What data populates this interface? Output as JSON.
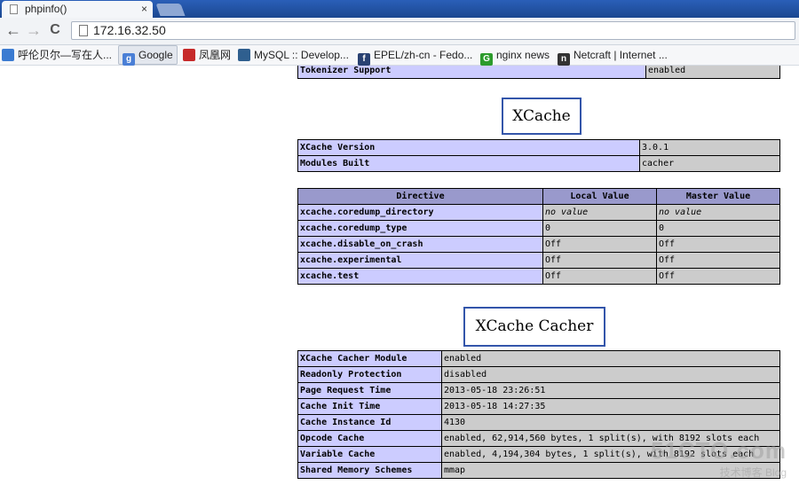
{
  "browser": {
    "tab_title": "phpinfo()",
    "tab_close": "×",
    "back": "←",
    "forward": "→",
    "reload": "C",
    "url": "172.16.32.50"
  },
  "bookmarks": [
    {
      "label": "呼伦贝尔—写在人...",
      "icon": "bookmark-icon",
      "color": "#3b7bd1"
    },
    {
      "label": "Google",
      "icon": "google-icon",
      "color": "#4a7fd6"
    },
    {
      "label": "凤凰网",
      "icon": "ifeng-icon",
      "color": "#c62a2a"
    },
    {
      "label": "MySQL :: Develop...",
      "icon": "mysql-icon",
      "color": "#2f5f8f"
    },
    {
      "label": "EPEL/zh-cn - Fedo...",
      "icon": "fedora-icon",
      "color": "#294172"
    },
    {
      "label": "nginx news",
      "icon": "nginx-icon",
      "color": "#2c9b2c"
    },
    {
      "label": "Netcraft | Internet ...",
      "icon": "netcraft-icon",
      "color": "#333333"
    }
  ],
  "tokenizer_row": {
    "label": "Tokenizer Support",
    "value": "enabled"
  },
  "xcache_heading": "XCache",
  "xcache_info": [
    {
      "label": "XCache Version",
      "value": "3.0.1"
    },
    {
      "label": "Modules Built",
      "value": "cacher"
    }
  ],
  "directive_headers": {
    "directive": "Directive",
    "local": "Local Value",
    "master": "Master Value"
  },
  "directives": [
    {
      "name": "xcache.coredump_directory",
      "local": "no value",
      "master": "no value"
    },
    {
      "name": "xcache.coredump_type",
      "local": "0",
      "master": "0"
    },
    {
      "name": "xcache.disable_on_crash",
      "local": "Off",
      "master": "Off"
    },
    {
      "name": "xcache.experimental",
      "local": "Off",
      "master": "Off"
    },
    {
      "name": "xcache.test",
      "local": "Off",
      "master": "Off"
    }
  ],
  "cacher_heading": "XCache Cacher",
  "cacher_rows": [
    {
      "label": "XCache Cacher Module",
      "value": "enabled"
    },
    {
      "label": "Readonly Protection",
      "value": "disabled"
    },
    {
      "label": "Page Request Time",
      "value": "2013-05-18 23:26:51"
    },
    {
      "label": "Cache Init Time",
      "value": "2013-05-18 14:27:35"
    },
    {
      "label": "Cache Instance Id",
      "value": "4130"
    },
    {
      "label": "Opcode Cache",
      "value": "enabled, 62,914,560 bytes, 1 split(s), with 8192 slots each"
    },
    {
      "label": "Variable Cache",
      "value": "enabled, 4,194,304 bytes, 1 split(s), with 8192 slots each"
    },
    {
      "label": "Shared Memory Schemes",
      "value": "mmap"
    }
  ],
  "watermark": {
    "big": "51CTO.com",
    "small": "技术博客  Blog"
  }
}
